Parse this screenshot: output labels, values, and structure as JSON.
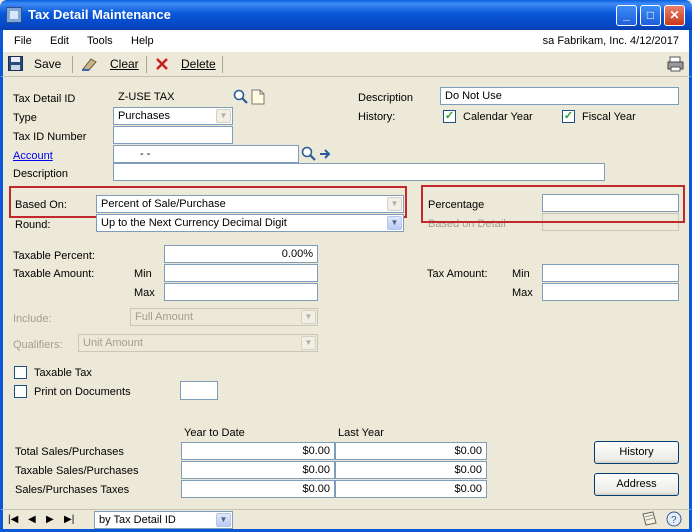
{
  "window": {
    "title": "Tax Detail Maintenance",
    "min_glyph": "_",
    "max_glyph": "□",
    "close_glyph": "✕"
  },
  "menu": {
    "items": [
      "File",
      "Edit",
      "Tools",
      "Help"
    ],
    "session": "sa  Fabrikam, Inc.  4/12/2017"
  },
  "toolbar": {
    "save_label": "Save",
    "clear_label": "Clear",
    "delete_label": "Delete"
  },
  "form": {
    "tax_detail_id_label": "Tax Detail ID",
    "tax_detail_id_value": "Z-USE TAX",
    "type_label": "Type",
    "type_value": "Purchases",
    "tax_id_number_label": "Tax ID Number",
    "tax_id_number_value": "",
    "account_label": "Account",
    "account_value": "-       -",
    "description_label": "Description",
    "description_value": "",
    "right_description_label": "Description",
    "right_description_value": "Do Not Use",
    "history_label": "History:",
    "calendar_year_label": "Calendar Year",
    "fiscal_year_label": "Fiscal Year",
    "based_on_label": "Based On:",
    "based_on_value": "Percent of Sale/Purchase",
    "round_label": "Round:",
    "round_value": "Up to the Next Currency Decimal Digit",
    "percentage_label": "Percentage",
    "percentage_value": "",
    "based_on_detail_label": "Based on Detail",
    "taxable_percent_label": "Taxable Percent:",
    "taxable_percent_value": "0.00%",
    "taxable_amount_label": "Taxable Amount:",
    "min_label": "Min",
    "max_label": "Max",
    "tax_amount_label": "Tax Amount:",
    "include_label": "Include:",
    "include_value": "Full Amount",
    "qualifiers_label": "Qualifiers:",
    "qualifiers_value": "Unit Amount",
    "taxable_tax_label": "Taxable Tax",
    "print_on_documents_label": "Print on Documents"
  },
  "summary": {
    "col_ytd": "Year to Date",
    "col_last_year": "Last Year",
    "rows": [
      {
        "label": "Total Sales/Purchases",
        "ytd": "$0.00",
        "last": "$0.00"
      },
      {
        "label": "Taxable Sales/Purchases",
        "ytd": "$0.00",
        "last": "$0.00"
      },
      {
        "label": "Sales/Purchases Taxes",
        "ytd": "$0.00",
        "last": "$0.00"
      }
    ]
  },
  "buttons": {
    "history_label": "History",
    "address_label": "Address"
  },
  "status": {
    "sort_value": "by Tax Detail ID"
  },
  "icons": {
    "save": "save-icon",
    "clear": "clear-icon",
    "delete": "delete-icon",
    "print": "print-icon",
    "lookup": "lookup-icon",
    "note": "note-icon",
    "expand": "expand-arrow-icon"
  }
}
